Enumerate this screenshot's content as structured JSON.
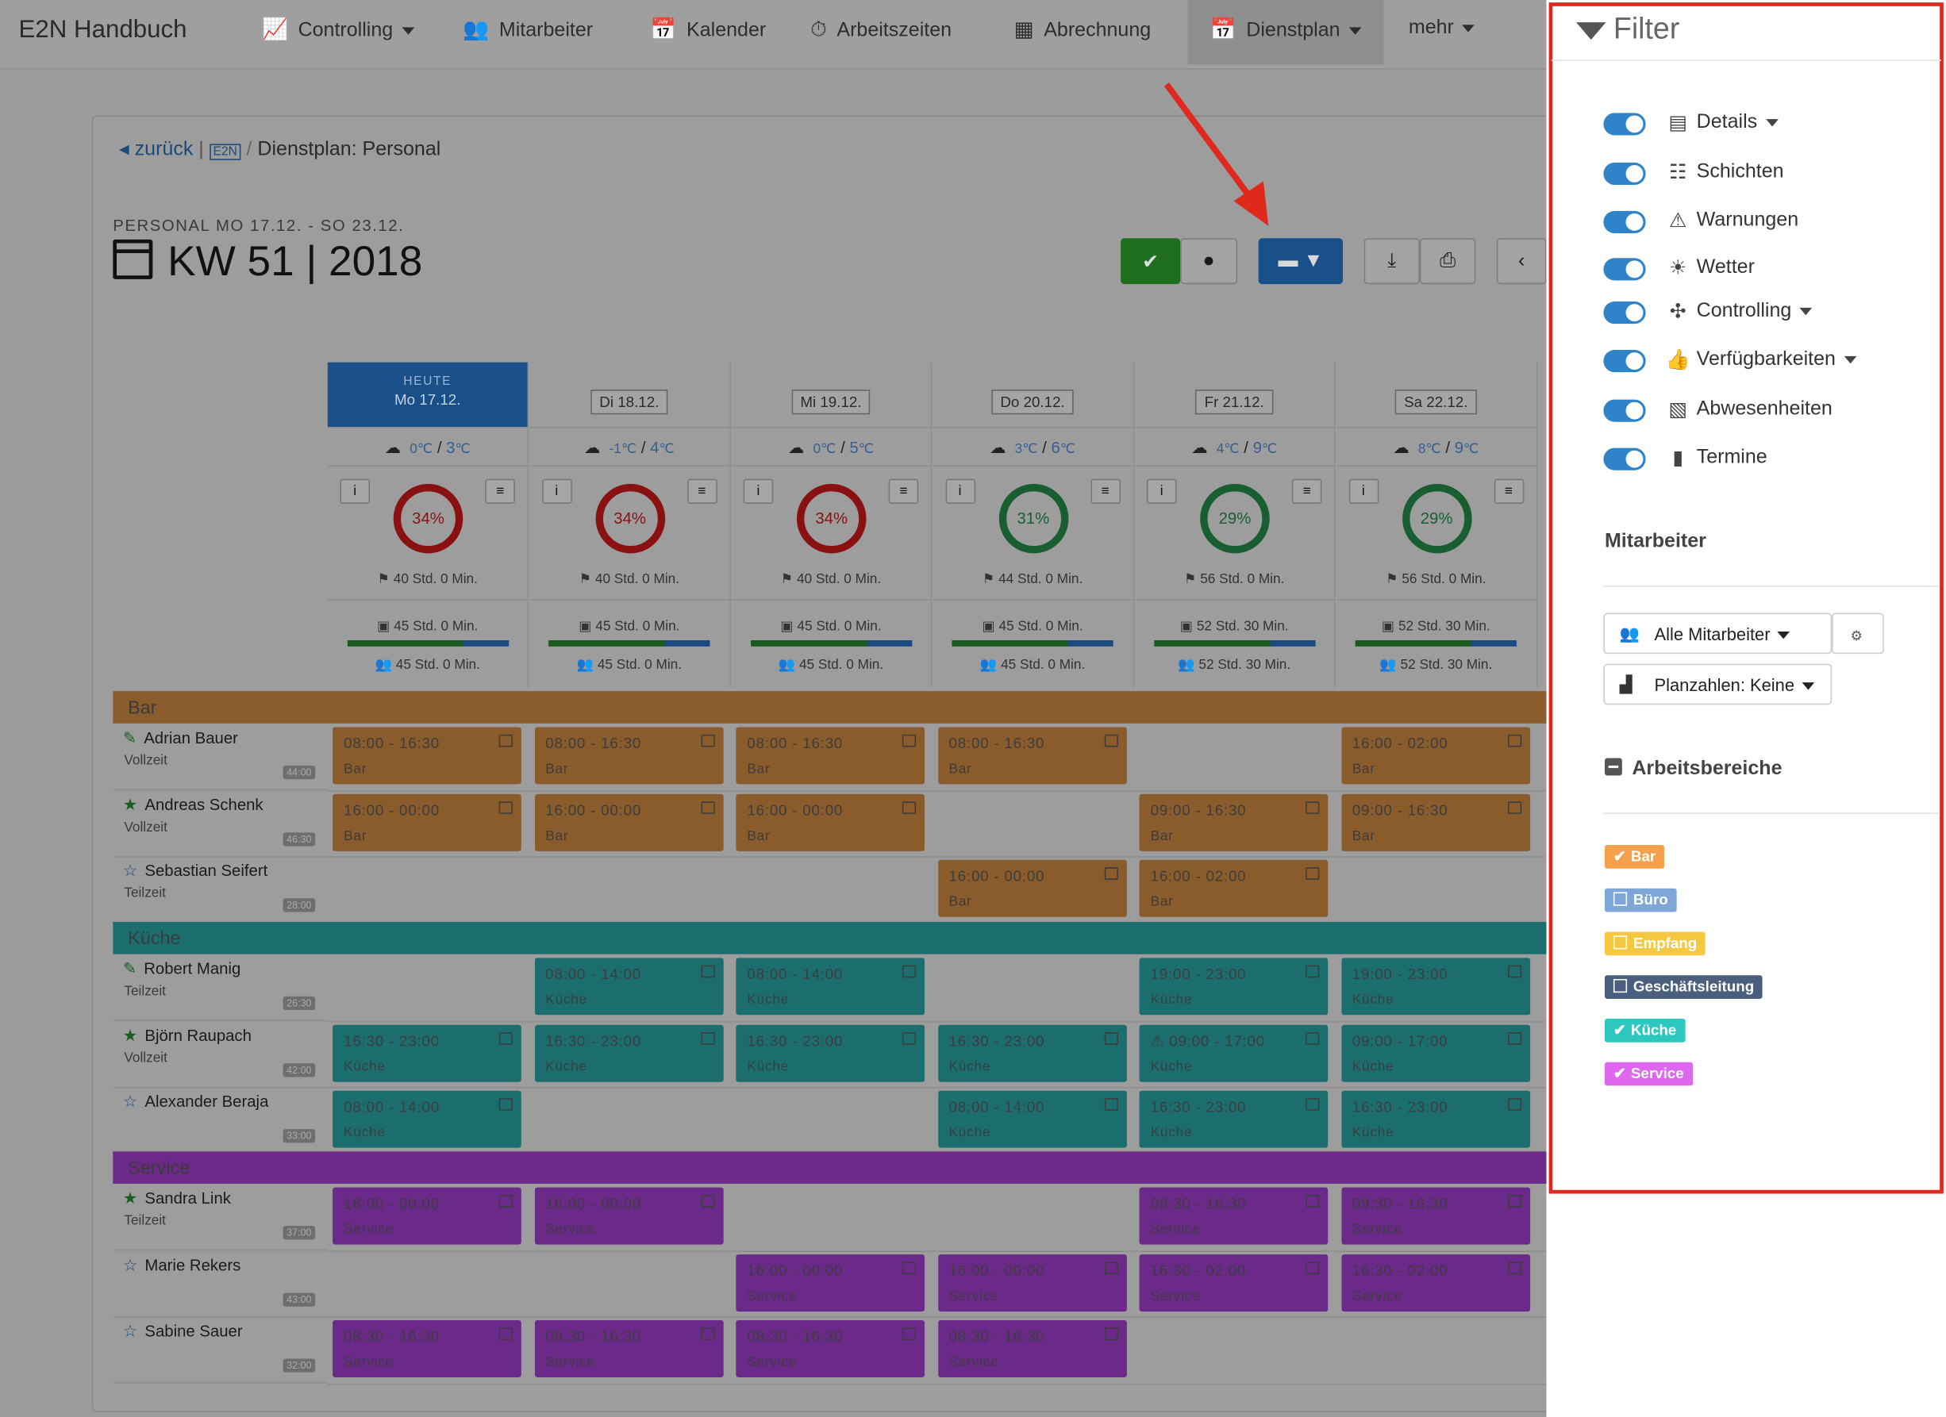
{
  "app": {
    "title": "E2N Handbuch"
  },
  "nav": [
    {
      "label": "Controlling",
      "icon": "chart-icon",
      "dropdown": true
    },
    {
      "label": "Mitarbeiter",
      "icon": "users-icon",
      "dropdown": false
    },
    {
      "label": "Kalender",
      "icon": "calendar-icon",
      "dropdown": false
    },
    {
      "label": "Arbeitszeiten",
      "icon": "stopwatch-icon",
      "dropdown": false
    },
    {
      "label": "Abrechnung",
      "icon": "grid-icon",
      "dropdown": false
    },
    {
      "label": "Dienstplan",
      "icon": "calendar-icon",
      "dropdown": true,
      "active": true
    },
    {
      "label": "mehr",
      "icon": "",
      "dropdown": true
    }
  ],
  "breadcrumb": {
    "back": "zurück",
    "current": "Dienstplan: Personal"
  },
  "page": {
    "subtitle": "PERSONAL  MO 17.12. - SO 23.12.",
    "title": "KW 51 | 2018"
  },
  "days": [
    {
      "label": "Mo 17.12.",
      "today": true,
      "today_label": "HEUTE",
      "tmin": "0",
      "tmax": "3",
      "percent": "34%",
      "ring": "red",
      "target": "40 Std. 0 Min.",
      "plan": "45 Std. 0 Min.",
      "staff": "45 Std. 0 Min."
    },
    {
      "label": "Di 18.12.",
      "tmin": "-1",
      "tmax": "4",
      "percent": "34%",
      "ring": "red",
      "target": "40 Std. 0 Min.",
      "plan": "45 Std. 0 Min.",
      "staff": "45 Std. 0 Min."
    },
    {
      "label": "Mi 19.12.",
      "tmin": "0",
      "tmax": "5",
      "percent": "34%",
      "ring": "red",
      "target": "40 Std. 0 Min.",
      "plan": "45 Std. 0 Min.",
      "staff": "45 Std. 0 Min."
    },
    {
      "label": "Do 20.12.",
      "tmin": "3",
      "tmax": "6",
      "percent": "31%",
      "ring": "grn",
      "target": "44 Std. 0 Min.",
      "plan": "45 Std. 0 Min.",
      "staff": "45 Std. 0 Min."
    },
    {
      "label": "Fr 21.12.",
      "tmin": "4",
      "tmax": "9",
      "percent": "29%",
      "ring": "grn",
      "target": "56 Std. 0 Min.",
      "plan": "52 Std. 30 Min.",
      "staff": "52 Std. 30 Min."
    },
    {
      "label": "Sa 22.12.",
      "tmin": "8",
      "tmax": "9",
      "percent": "29%",
      "ring": "grn",
      "target": "56 Std. 0 Min.",
      "plan": "52 Std. 30 Min.",
      "staff": "52 Std. 30 Min."
    }
  ],
  "sections": [
    {
      "name": "Bar",
      "color": "#8a5c2c",
      "employees": [
        {
          "name": "Adrian Bauer",
          "type": "Vollzeit",
          "hours": "44:00",
          "star": "half",
          "shifts": [
            "08:00 - 16:30",
            "08:00 - 16:30",
            "08:00 - 16:30",
            "08:00 - 16:30",
            "",
            "16:00 - 02:00"
          ]
        },
        {
          "name": "Andreas Schenk",
          "type": "Vollzeit",
          "hours": "46:30",
          "star": "full",
          "shifts": [
            "16:00 - 00:00",
            "16:00 - 00:00",
            "16:00 - 00:00",
            "",
            "09:00 - 16:30",
            "09:00 - 16:30"
          ]
        },
        {
          "name": "Sebastian Seifert",
          "type": "Teilzeit",
          "hours": "28:00",
          "star": "empty",
          "shifts": [
            "",
            "",
            "",
            "16:00 - 00:00",
            "16:00 - 02:00",
            ""
          ]
        }
      ]
    },
    {
      "name": "Küche",
      "color": "#1c6e6e",
      "employees": [
        {
          "name": "Robert Manig",
          "type": "Teilzeit",
          "hours": "26:30",
          "star": "half",
          "shifts": [
            "",
            "08:00 - 14:00",
            "08:00 - 14:00",
            "",
            "19:00 - 23:00",
            "19:00 - 23:00"
          ]
        },
        {
          "name": "Björn Raupach",
          "type": "Vollzeit",
          "hours": "42:00",
          "star": "full",
          "shifts": [
            "16:30 - 23:00",
            "16:30 - 23:00",
            "16:30 - 23:00",
            "16:30 - 23:00",
            "09:00 - 17:00",
            "09:00 - 17:00"
          ]
        },
        {
          "name": "Alexander Beraja",
          "type": "",
          "hours": "33:00",
          "star": "outline",
          "shifts": [
            "08:00 - 14:00",
            "",
            "",
            "08:00 - 14:00",
            "16:30 - 23:00",
            "16:30 - 23:00"
          ]
        }
      ]
    },
    {
      "name": "Service",
      "color": "#6b2a8a",
      "employees": [
        {
          "name": "Sandra Link",
          "type": "Teilzeit",
          "hours": "37:00",
          "star": "full",
          "shifts": [
            "16:00 - 00:00",
            "16:00 - 00:00",
            "",
            "",
            "09:30 - 16:30",
            "09:30 - 16:30"
          ]
        },
        {
          "name": "Marie Rekers",
          "type": "",
          "hours": "43:00",
          "star": "outline",
          "shifts": [
            "",
            "",
            "16:00 - 00:00",
            "16:00 - 00:00",
            "16:30 - 02:00",
            "16:30 - 02:00"
          ]
        },
        {
          "name": "Sabine Sauer",
          "type": "",
          "hours": "32:00",
          "star": "outline",
          "shifts": [
            "08:30 - 16:30",
            "08:30 - 16:30",
            "08:30 - 16:30",
            "08:30 - 16:30",
            "",
            ""
          ]
        }
      ]
    }
  ],
  "filter": {
    "title": "Filter",
    "toggles": [
      {
        "label": "Details",
        "icon": "details-icon",
        "caret": true,
        "on": true
      },
      {
        "label": "Schichten",
        "icon": "shifts-icon",
        "caret": false,
        "on": true
      },
      {
        "label": "Warnungen",
        "icon": "warning-icon",
        "caret": false,
        "on": true
      },
      {
        "label": "Wetter",
        "icon": "weather-icon",
        "caret": false,
        "on": true
      },
      {
        "label": "Controlling",
        "icon": "controlling-icon",
        "caret": true,
        "on": true
      },
      {
        "label": "Verfügbarkeiten",
        "icon": "thumbs-up-icon",
        "caret": true,
        "on": true
      },
      {
        "label": "Abwesenheiten",
        "icon": "absence-icon",
        "caret": false,
        "on": true
      },
      {
        "label": "Termine",
        "icon": "bookmark-icon",
        "caret": false,
        "on": true
      }
    ],
    "employees_heading": "Mitarbeiter",
    "employees_select": "Alle Mitarbeiter",
    "plan_select": "Planzahlen: Keine",
    "areas_heading": "Arbeitsbereiche",
    "areas": [
      {
        "label": "Bar",
        "checked": true,
        "color": "#f5a04a"
      },
      {
        "label": "Büro",
        "checked": false,
        "color": "#7ea7d8"
      },
      {
        "label": "Empfang",
        "checked": false,
        "color": "#f5c842"
      },
      {
        "label": "Geschäftsleitung",
        "checked": false,
        "color": "#4a5e7e"
      },
      {
        "label": "Küche",
        "checked": true,
        "color": "#2ec7c0"
      },
      {
        "label": "Service",
        "checked": true,
        "color": "#df67f0"
      }
    ]
  }
}
